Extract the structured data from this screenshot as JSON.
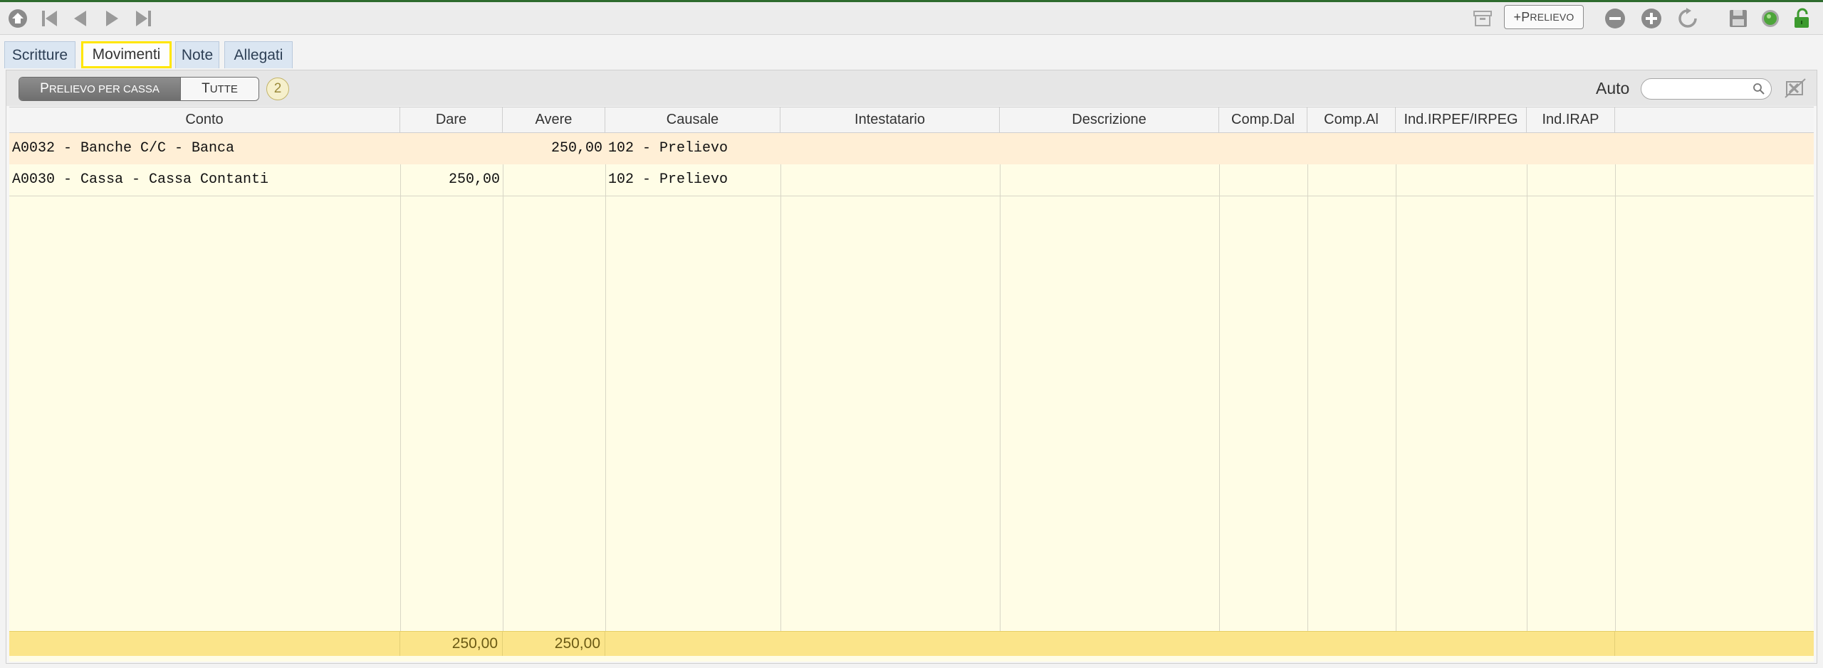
{
  "toolbar": {
    "prelievo_plus": "+ ",
    "prelievo_first": "P",
    "prelievo_rest": "RELIEVO"
  },
  "tabs": [
    {
      "label": "Scritture"
    },
    {
      "label": "Movimenti",
      "active": true
    },
    {
      "label": "Note"
    },
    {
      "label": "Allegati"
    }
  ],
  "filter": {
    "seg1_first": "P",
    "seg1_rest": "RELIEVO PER CASSA",
    "seg2_first": "T",
    "seg2_rest": "UTTE",
    "count": "2",
    "auto_label": "Auto",
    "search_value": ""
  },
  "table": {
    "columns": [
      "Conto",
      "Dare",
      "Avere",
      "Causale",
      "Intestatario",
      "Descrizione",
      "Comp.Dal",
      "Comp.Al",
      "Ind.IRPEF/IRPEG",
      "Ind.IRAP"
    ],
    "rows": [
      {
        "conto": "A0032 - Banche C/C - Banca",
        "dare": "",
        "avere": "250,00",
        "causale": "102 - Prelievo"
      },
      {
        "conto": "A0030 - Cassa - Cassa Contanti",
        "dare": "250,00",
        "avere": "",
        "causale": "102 - Prelievo"
      }
    ],
    "totals": {
      "dare": "250,00",
      "avere": "250,00"
    }
  },
  "colors": {
    "row_selected": "#ffefd6",
    "grid_bg": "#fffde6",
    "footer_bg": "#fbe58a",
    "active_tab_border": "#ffe600"
  }
}
